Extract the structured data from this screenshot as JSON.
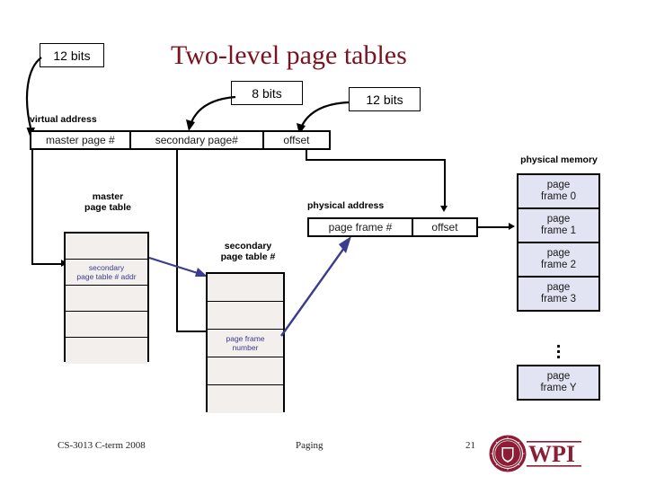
{
  "slide": {
    "title": "Two-level page tables",
    "title_color": "#7B1220"
  },
  "callouts": [
    {
      "id": "master-bits",
      "label": "12 bits"
    },
    {
      "id": "secondary-bits",
      "label": "8 bits"
    },
    {
      "id": "offset-bits",
      "label": "12 bits"
    }
  ],
  "virtual_address": {
    "label": "virtual address",
    "fields": [
      {
        "name": "master",
        "label": "master page #"
      },
      {
        "name": "secondary",
        "label": "secondary page#"
      },
      {
        "name": "offset",
        "label": "offset"
      }
    ]
  },
  "physical_address": {
    "label": "physical address",
    "fields": [
      {
        "name": "frame",
        "label": "page frame #"
      },
      {
        "name": "offset",
        "label": "offset"
      }
    ]
  },
  "master_table": {
    "caption_line1": "master",
    "caption_line2": "page table",
    "rows": [
      {
        "label": ""
      },
      {
        "label": "secondary\npage table # addr",
        "line1": "secondary",
        "line2": "page table # addr"
      },
      {
        "label": ""
      },
      {
        "label": ""
      },
      {
        "label": ""
      }
    ]
  },
  "secondary_table": {
    "caption_line1": "secondary",
    "caption_line2": "page table #",
    "rows": [
      {
        "label": ""
      },
      {
        "label": ""
      },
      {
        "label": "page frame\nnumber",
        "line1": "page frame",
        "line2": "number"
      },
      {
        "label": ""
      },
      {
        "label": ""
      }
    ]
  },
  "physical_memory": {
    "label": "physical memory",
    "frames": [
      {
        "line1": "page",
        "line2": "frame 0"
      },
      {
        "line1": "page",
        "line2": "frame 1"
      },
      {
        "line1": "page",
        "line2": "frame 2"
      },
      {
        "line1": "page",
        "line2": "frame 3"
      }
    ],
    "ellipsis": "⋮",
    "last_frame": {
      "line1": "page",
      "line2": "frame Y"
    }
  },
  "footer": {
    "course": "CS-3013 C-term 2008",
    "topic": "Paging",
    "page_number": "21",
    "logo_text": "WPI",
    "logo_color": "#8C1D35"
  }
}
